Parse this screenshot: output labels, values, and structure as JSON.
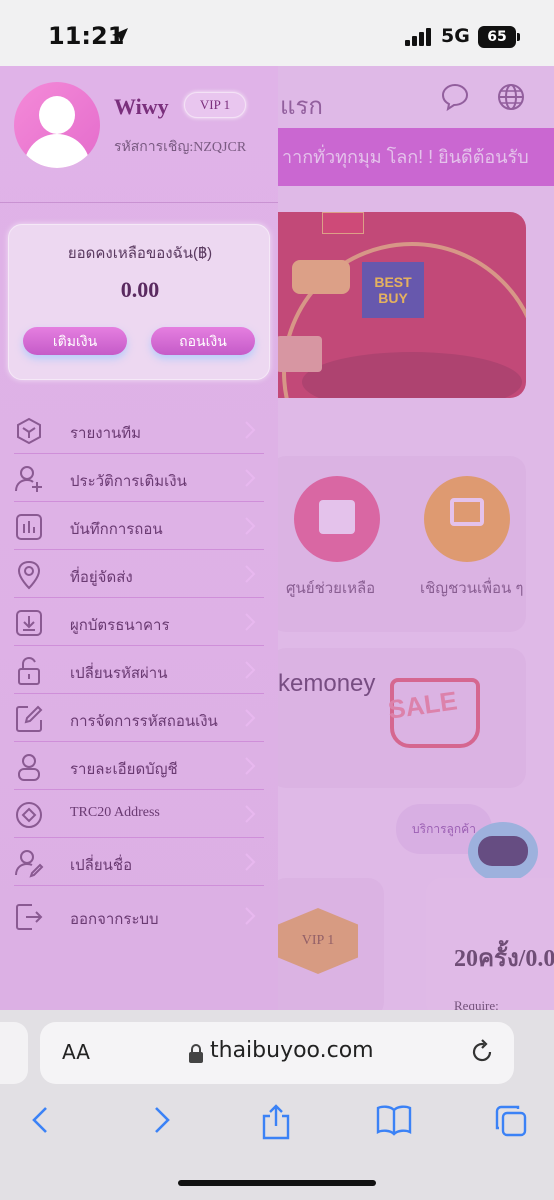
{
  "status_bar": {
    "time": "11:21",
    "network": "5G",
    "battery": "65"
  },
  "background_page": {
    "header_title": "แรก",
    "marquee": "าากทั่วทุกมุม โลก! ! ยินดีต้อนรับ",
    "banner_brand": "BEST BUY",
    "services": [
      {
        "label": "ศูนย์ช่วยเหลือ",
        "icon": "shirt-icon"
      },
      {
        "label": "เชิญชวนเพื่อน ๆ",
        "icon": "lamp-icon"
      }
    ],
    "promo_text": "kemoney",
    "promo_sale_text": "SALE",
    "assistant_bubble": "บริการลูกค้า",
    "vip_badge": "VIP 1",
    "task_value": "20ครั้ง/0.0",
    "require_label": "Require:"
  },
  "drawer": {
    "username": "Wiwy",
    "vip_level": "VIP 1",
    "invite_code": "รหัสการเชิญ:NZQJCR",
    "balance_label": "ยอดคงเหลือของฉัน(฿)",
    "balance_value": "0.00",
    "deposit_button": "เติมเงิน",
    "withdraw_button": "ถอนเงิน",
    "menu": [
      {
        "label": "รายงานทีม",
        "icon": "cube-icon"
      },
      {
        "label": "ประวัติการเติมเงิน",
        "icon": "user-add-icon"
      },
      {
        "label": "บันทึกการถอน",
        "icon": "bar-chart-icon"
      },
      {
        "label": "ที่อยู่จัดส่ง",
        "icon": "location-pin-icon"
      },
      {
        "label": "ผูกบัตรธนาคาร",
        "icon": "download-box-icon"
      },
      {
        "label": "เปลี่ยนรหัสผ่าน",
        "icon": "unlock-icon"
      },
      {
        "label": "การจัดการรหัสถอนเงิน",
        "icon": "edit-square-icon"
      },
      {
        "label": "รายละเอียดบัญชี",
        "icon": "user-icon"
      },
      {
        "label": "TRC20 Address",
        "icon": "target-circle-icon"
      },
      {
        "label": "เปลี่ยนชื่อ",
        "icon": "user-edit-icon"
      },
      {
        "label": "ออกจากระบบ",
        "icon": "logout-icon"
      }
    ]
  },
  "browser": {
    "text_size_label": "AA",
    "url": "thaibuyoo.com"
  },
  "colors": {
    "drawer_bg": "#e0b3e8",
    "accent_button": "#d56ad8",
    "marquee_bg": "#d05ad0",
    "text_primary": "#6a3a72"
  }
}
